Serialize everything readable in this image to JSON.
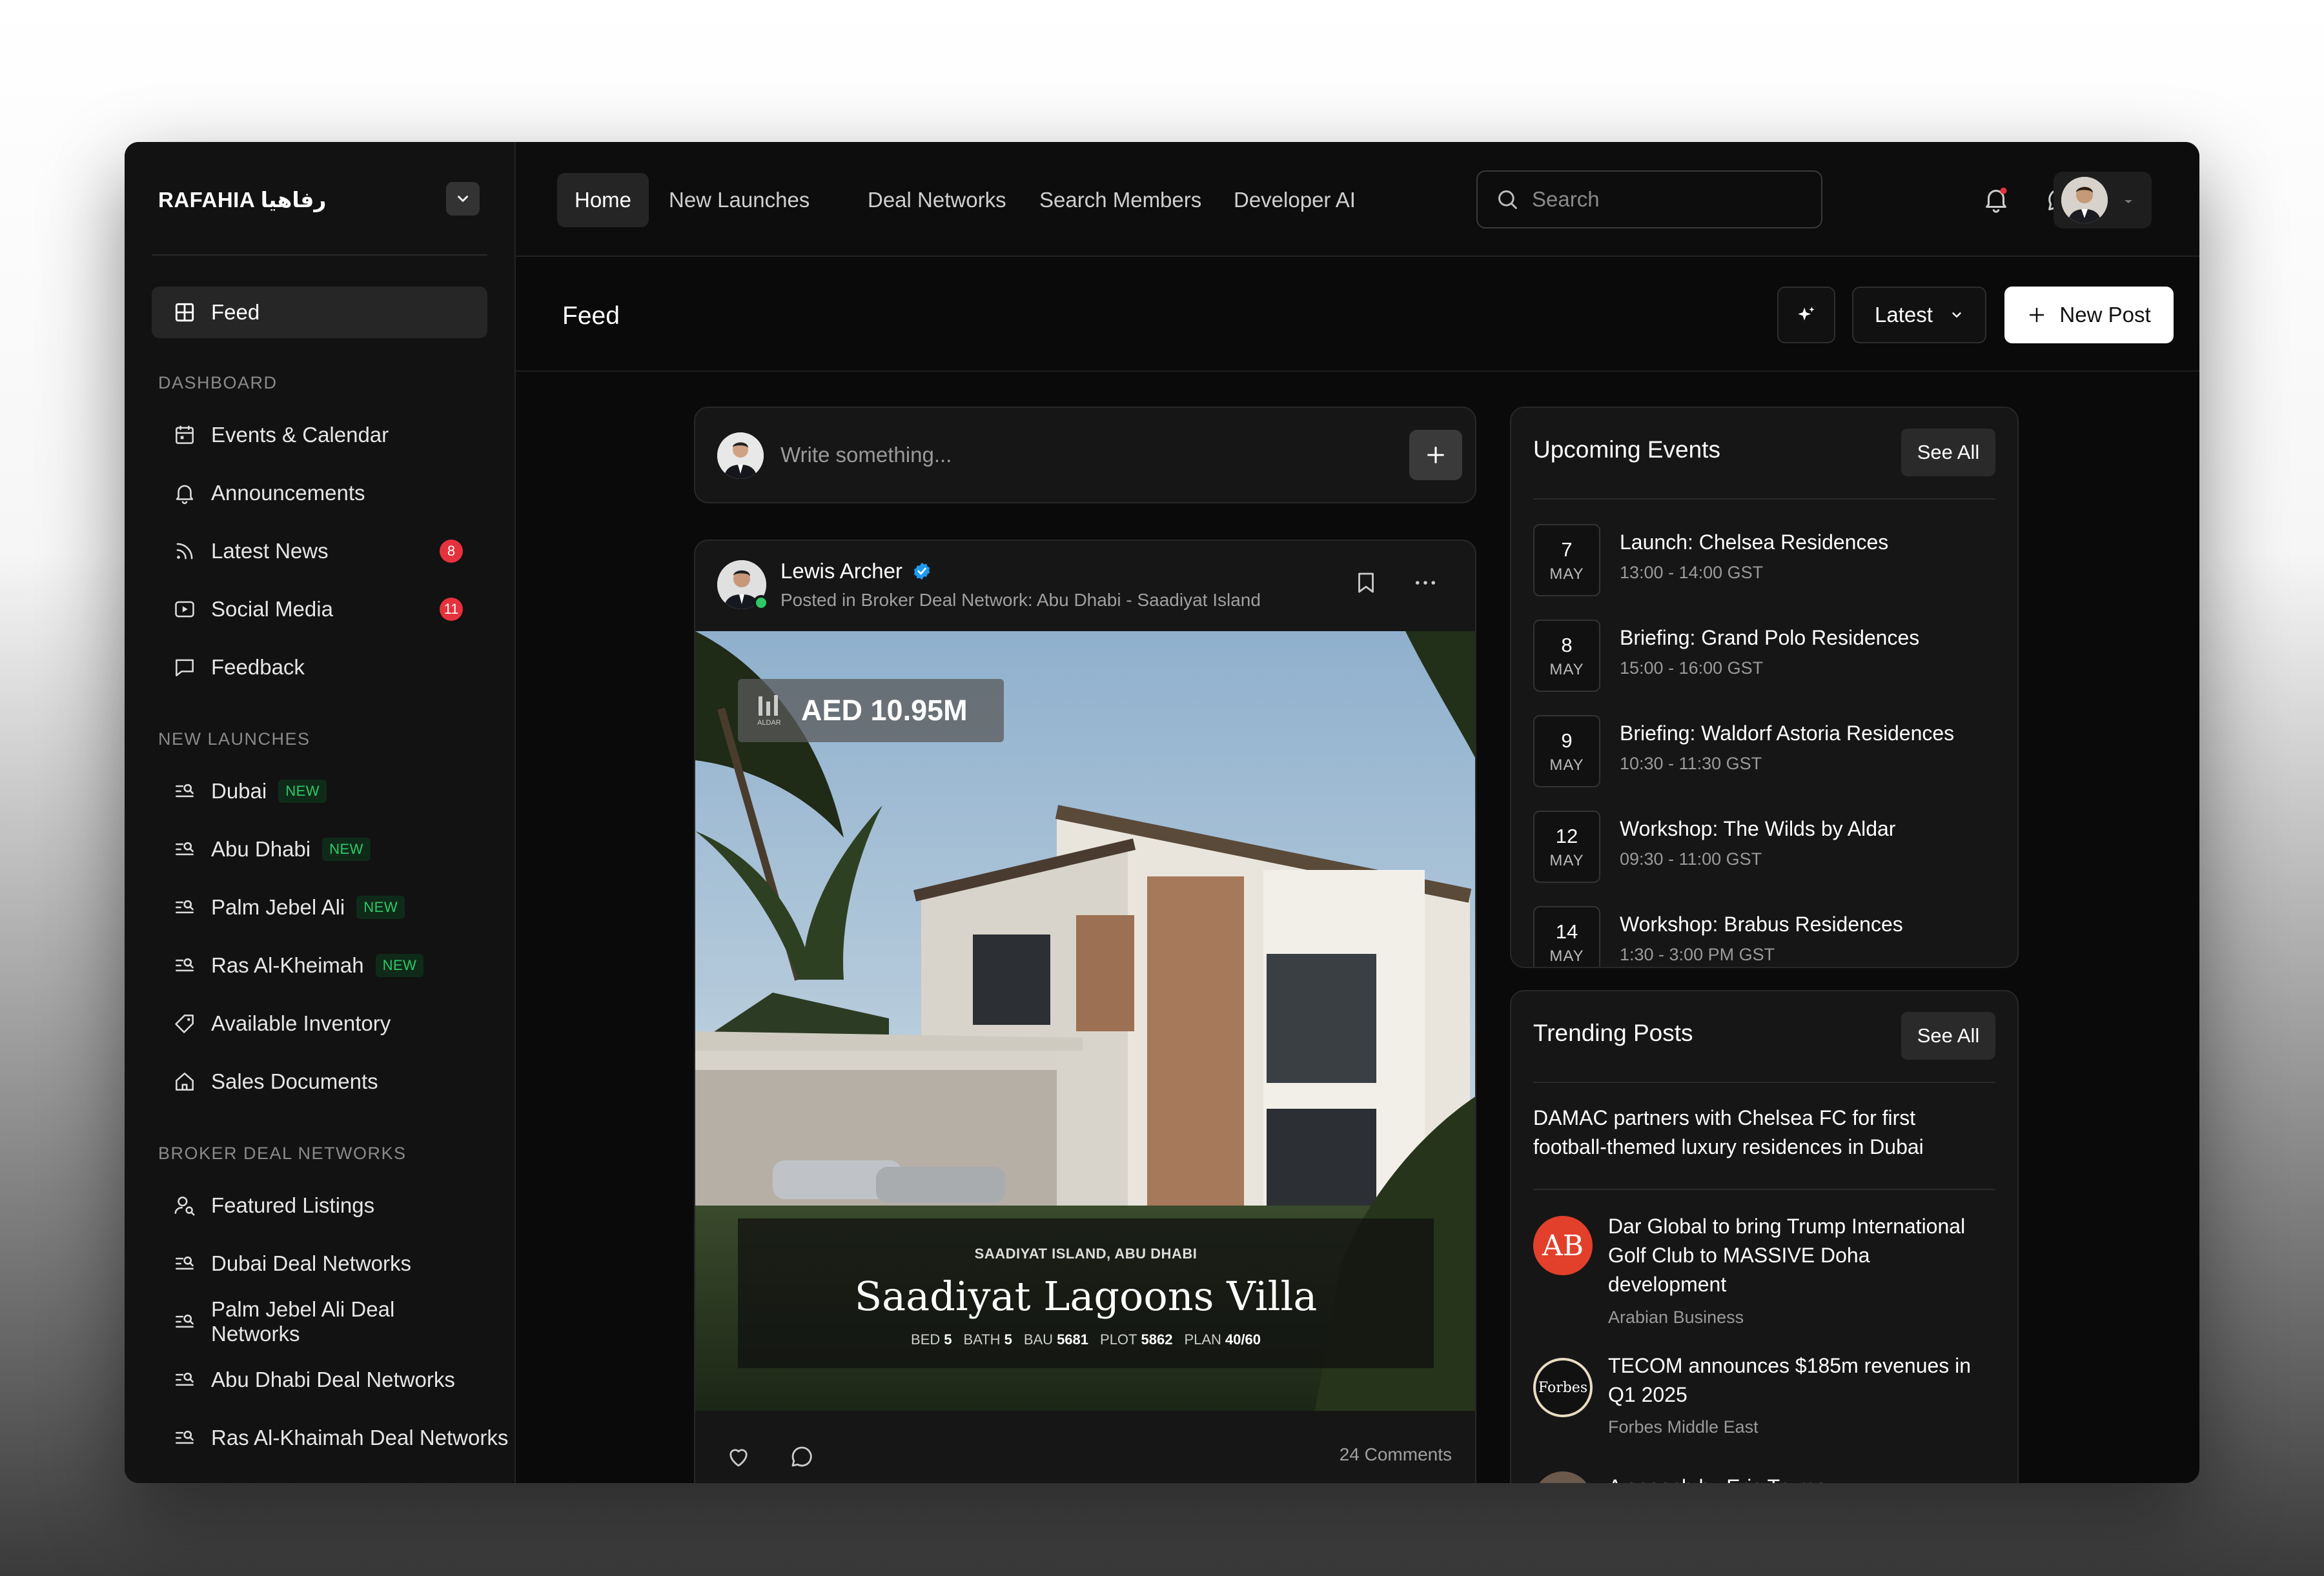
{
  "brand": {
    "name": "RAFAHIA رفاهيا"
  },
  "sidebar": {
    "feed_label": "Feed",
    "sections": {
      "dashboard": "DASHBOARD",
      "new_launches": "NEW LAUNCHES",
      "broker": "BROKER DEAL NETWORKS"
    },
    "dashboard_items": [
      {
        "label": "Events & Calendar"
      },
      {
        "label": "Announcements"
      },
      {
        "label": "Latest News",
        "badge": "8"
      },
      {
        "label": "Social Media",
        "badge": "11"
      },
      {
        "label": "Feedback"
      }
    ],
    "launch_items": [
      {
        "label": "Dubai",
        "tag": "NEW"
      },
      {
        "label": "Abu Dhabi",
        "tag": "NEW"
      },
      {
        "label": "Palm Jebel Ali",
        "tag": "NEW"
      },
      {
        "label": "Ras Al-Kheimah",
        "tag": "NEW"
      },
      {
        "label": "Available Inventory"
      },
      {
        "label": "Sales Documents"
      }
    ],
    "broker_items": [
      {
        "label": "Featured Listings"
      },
      {
        "label": "Dubai Deal Networks"
      },
      {
        "label": "Palm Jebel Ali Deal Networks"
      },
      {
        "label": "Abu Dhabi Deal Networks"
      },
      {
        "label": "Ras Al-Khaimah Deal Networks"
      }
    ]
  },
  "topnav": {
    "tabs": [
      {
        "label": "Home"
      },
      {
        "label": "New Launches"
      },
      {
        "label": "Deal Networks"
      },
      {
        "label": "Search Members"
      },
      {
        "label": "Developer AI"
      }
    ],
    "search_placeholder": "Search"
  },
  "feed": {
    "title": "Feed",
    "sort_label": "Latest",
    "new_post_label": "New Post",
    "compose_placeholder": "Write something...",
    "post": {
      "author": "Lewis Archer",
      "posted_in": "Posted in Broker Deal Network: Abu Dhabi - Saadiyat Island",
      "price": "AED 10.95M",
      "logo_text": "ALDAR",
      "location": "SAADIYAT ISLAND, ABU DHABI",
      "villa_name": "Saadiyat Lagoons Villa",
      "specs": [
        {
          "k": "BED",
          "v": "5"
        },
        {
          "k": "BATH",
          "v": "5"
        },
        {
          "k": "BAU",
          "v": "5681"
        },
        {
          "k": "PLOT",
          "v": "5862"
        },
        {
          "k": "PLAN",
          "v": "40/60"
        }
      ],
      "comments": "24 Comments"
    }
  },
  "events": {
    "title": "Upcoming Events",
    "see_all": "See All",
    "items": [
      {
        "day": "7",
        "month": "MAY",
        "title": "Launch: Chelsea Residences",
        "time": "13:00 - 14:00 GST"
      },
      {
        "day": "8",
        "month": "MAY",
        "title": "Briefing: Grand Polo Residences",
        "time": "15:00 - 16:00 GST"
      },
      {
        "day": "9",
        "month": "MAY",
        "title": "Briefing: Waldorf Astoria Residences",
        "time": "10:30 - 11:30 GST"
      },
      {
        "day": "12",
        "month": "MAY",
        "title": "Workshop: The Wilds by Aldar",
        "time": "09:30 - 11:00 GST"
      },
      {
        "day": "14",
        "month": "MAY",
        "title": "Workshop: Brabus Residences",
        "time": "1:30 - 3:00 PM GST"
      }
    ]
  },
  "trending": {
    "title": "Trending Posts",
    "see_all": "See All",
    "items": [
      {
        "line1": "DAMAC partners with Chelsea FC for first",
        "line2": "football-themed luxury residences in Dubai"
      },
      {
        "line1": "Dar Global to bring Trump International",
        "line2": "Golf Club to MASSIVE Doha",
        "line3": "development",
        "source": "Arabian Business",
        "logo": "AB"
      },
      {
        "line1": "TECOM announces $185m revenues in",
        "line2": "Q1 2025",
        "source": "Forbes Middle East",
        "logo": "Forbes"
      },
      {
        "line1": "A speech by Eric Trump"
      }
    ]
  },
  "colors": {
    "accent_red": "#e5323c",
    "new_green": "#2ec866",
    "verified_blue": "#1d9bf0"
  }
}
